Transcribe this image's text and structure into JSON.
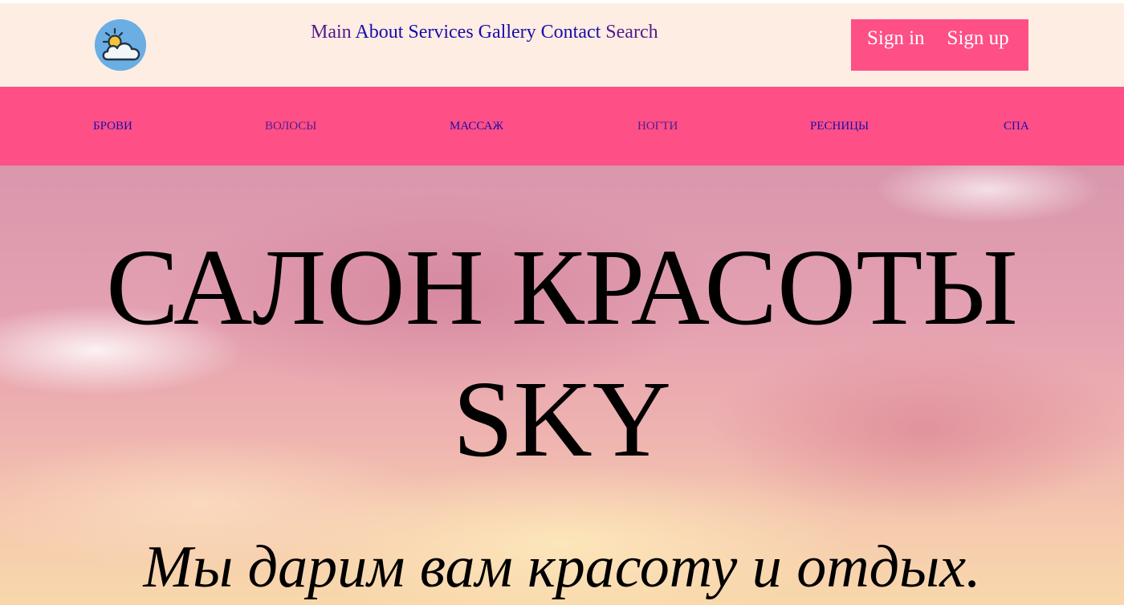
{
  "header": {
    "logo": "sun-cloud-logo",
    "nav": [
      "Main",
      "About",
      "Services",
      "Gallery",
      "Contact",
      "Search"
    ],
    "sign_in": "Sign in",
    "sign_up": "Sign up"
  },
  "categories": [
    "БРОВИ",
    "ВОЛОСЫ",
    "МАССАЖ",
    "НОГТИ",
    "РЕСНИЦЫ",
    "СПА"
  ],
  "hero": {
    "title_line1": "САЛОН КРАСОТЫ",
    "title_line2": "SKY",
    "subtitle": "Мы дарим вам красоту и отдых."
  },
  "colors": {
    "header_bg": "#fdede3",
    "accent_pink": "#fe4f86",
    "link_blue": "#1a0dab",
    "link_visited": "#551a8b",
    "logo_blue": "#6aaee4"
  }
}
